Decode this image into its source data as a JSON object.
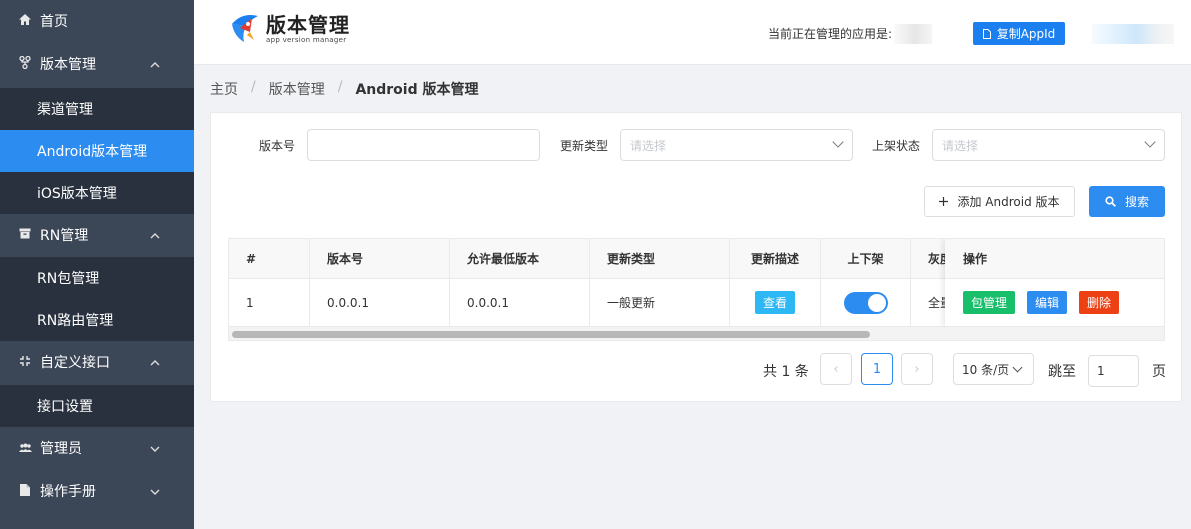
{
  "sidebar": {
    "items": [
      {
        "label": "首页",
        "icon": "home-icon"
      },
      {
        "label": "版本管理",
        "icon": "branch-icon",
        "expanded": true
      },
      {
        "label": "渠道管理"
      },
      {
        "label": "Android版本管理",
        "active": true
      },
      {
        "label": "iOS版本管理"
      },
      {
        "label": "RN管理",
        "icon": "package-icon",
        "expanded": true
      },
      {
        "label": "RN包管理"
      },
      {
        "label": "RN路由管理"
      },
      {
        "label": "自定义接口",
        "icon": "api-icon",
        "expanded": true
      },
      {
        "label": "接口设置"
      },
      {
        "label": "管理员",
        "icon": "users-icon",
        "expanded": false
      },
      {
        "label": "操作手册",
        "icon": "document-icon",
        "expanded": false
      }
    ]
  },
  "header": {
    "logo_title": "版本管理",
    "logo_sub": "app version manager",
    "current_app_label": "当前正在管理的应用是:",
    "copy_button": "复制AppId"
  },
  "breadcrumb": [
    "主页",
    "版本管理",
    "Android 版本管理"
  ],
  "filters": {
    "version_label": "版本号",
    "version_value": "",
    "update_type_label": "更新类型",
    "update_type_placeholder": "请选择",
    "shelf_label": "上架状态",
    "shelf_placeholder": "请选择"
  },
  "actions": {
    "add_label": "添加 Android 版本",
    "search_label": "搜索"
  },
  "table": {
    "columns": [
      "#",
      "版本号",
      "允许最低版本",
      "更新类型",
      "更新描述",
      "上下架",
      "灰度",
      "操作"
    ],
    "rows": [
      {
        "index": "1",
        "version": "0.0.0.1",
        "min_version": "0.0.0.1",
        "update_type": "一般更新",
        "description_button": "查看",
        "on_shelf": true,
        "gray": "全量",
        "ops": [
          "包管理",
          "编辑",
          "删除"
        ]
      }
    ]
  },
  "pagination": {
    "total": "共 1 条",
    "prev": "‹",
    "current": "1",
    "next": "›",
    "page_size": "10 条/页",
    "jump_label": "跳至",
    "jump_value": "1",
    "page_suffix": "页"
  },
  "colors": {
    "primary": "#2d8cf0",
    "success": "#19be6b",
    "danger": "#ed4014",
    "info": "#2db7f5",
    "sidebar": "#3b4657",
    "sidebar_sub": "#28313d"
  }
}
